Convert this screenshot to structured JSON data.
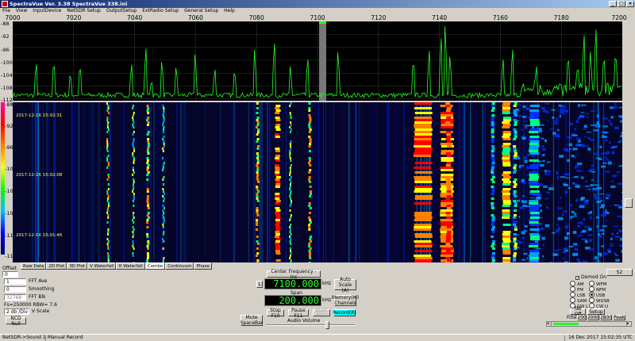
{
  "window": {
    "title": "SpectraVue Ver. 3.38  SpectraVue 338.ini",
    "minimize": "_",
    "maximize": "□",
    "close": "×"
  },
  "menu": [
    "File",
    "View",
    "InputDevice",
    "NetSDR Setup",
    "OutputSetup",
    "ExtRadio Setup",
    "General Setup",
    "Help"
  ],
  "freq_axis": [
    "7000",
    "7020",
    "7040",
    "7060",
    "7080",
    "7100",
    "7120",
    "7140",
    "7160",
    "7180",
    "7200"
  ],
  "spectrum_y": [
    "-88",
    "-92",
    "-96",
    "-100",
    "-104",
    "-108",
    "-112"
  ],
  "waterfall_y": [
    "-88",
    "-92",
    "-96",
    "-100",
    "-104",
    "-108",
    "-112",
    "-116"
  ],
  "timestamps": [
    "2017-12-16 15:02:31",
    "2017-12-16 15:02:08",
    "2017-12-16 15:01:46"
  ],
  "tabs": [
    "Raw Data",
    "2D Plot",
    "3D Plot",
    "V Waterfall",
    "H Waterfall",
    "Combo",
    "Continuum",
    "Phase"
  ],
  "active_tab": "Combo",
  "left": {
    "offset_label": "Offset",
    "offset_value": "0",
    "fft_ave_value": "1",
    "fft_ave_label": "FFT Ave",
    "smoothing_value": "0",
    "smoothing_label": "Smoothing",
    "fft_blk_value": "32768",
    "fft_blk_label": "FFT Blk",
    "fs_info": "Fs=250000 RBW= 7.6",
    "vscale_value": "2 db /Div",
    "vscale_label": "V Scale",
    "ncd_null": "NCD Null"
  },
  "center": {
    "center_freq_btn": "Center Frequency - Inc",
    "l_btn": "L",
    "center_freq": "7100.000",
    "khz": "kHz",
    "span_label": "Span",
    "span": "200.000",
    "auto_scale": "Auto Scale (A)",
    "memory": "Memory(M) Channels",
    "mute": "Mute SpaceBar",
    "stop": "Stop F10",
    "pause": "Pause F11",
    "start": "Start F12",
    "record": "Record(R)",
    "audio_volume": "Audio Volume"
  },
  "right": {
    "s2": "S2",
    "demod_on": "Demod On",
    "modes": [
      {
        "label": "AM",
        "on": false
      },
      {
        "label": "WFM",
        "on": false
      },
      {
        "label": "FM",
        "on": false
      },
      {
        "label": "NFM",
        "on": false
      },
      {
        "label": "LSB",
        "on": false
      },
      {
        "label": "USB",
        "on": true
      },
      {
        "label": "SAM",
        "on": false
      },
      {
        "label": "WUSB",
        "on": false
      },
      {
        "label": "CW L",
        "on": false
      },
      {
        "label": "CW U",
        "on": false
      }
    ],
    "nb_off": "NB Off",
    "setup": "Setup",
    "filter_label": "Filter",
    "filters": [
      "200",
      "2000",
      "2800"
    ],
    "peak": "Peak"
  },
  "status": {
    "device": "NetSDR->Sound 1",
    "record_mode": "Manual Record",
    "datetime": "16 Dec 2017   15:02:35 UTC"
  },
  "colors": {
    "trace": "#22ff22",
    "record_active": "#00ffff",
    "lcd_text": "#2cff2c"
  }
}
